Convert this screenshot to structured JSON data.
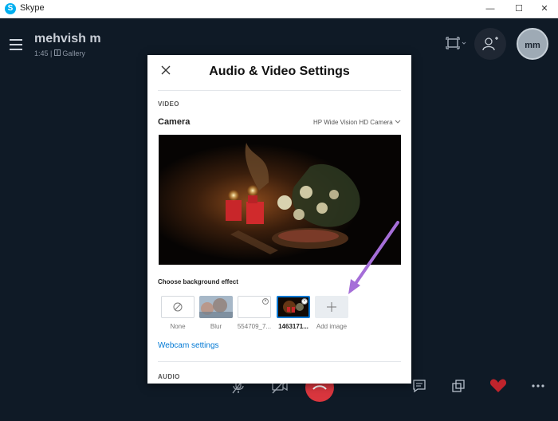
{
  "window": {
    "title": "Skype",
    "logo_letter": "S"
  },
  "call": {
    "caller_name": "mehvish m",
    "duration": "1:45",
    "separator": "|",
    "view_mode": "Gallery",
    "avatar_initials": "mm"
  },
  "dialog": {
    "title": "Audio & Video Settings",
    "video_section": "VIDEO",
    "camera_label": "Camera",
    "camera_selected": "HP Wide Vision HD Camera",
    "background_label": "Choose background effect",
    "effects": [
      {
        "label": "None",
        "selected": false
      },
      {
        "label": "Blur",
        "selected": false
      },
      {
        "label": "554709_7...",
        "selected": false
      },
      {
        "label": "1463171...",
        "selected": true
      },
      {
        "label": "Add image",
        "selected": false
      }
    ],
    "webcam_link": "Webcam settings",
    "audio_section": "AUDIO"
  },
  "colors": {
    "accent": "#0078d4",
    "end_call": "#d9363e",
    "heart": "#c0242c"
  },
  "icons": [
    "menu-icon",
    "layout-icon",
    "add-person-icon",
    "close-icon",
    "chevron-down-icon",
    "none-icon",
    "plus-icon",
    "chat-icon",
    "share-screen-icon",
    "heart-icon",
    "more-icon",
    "mute-icon",
    "camera-off-icon",
    "end-call-icon"
  ]
}
